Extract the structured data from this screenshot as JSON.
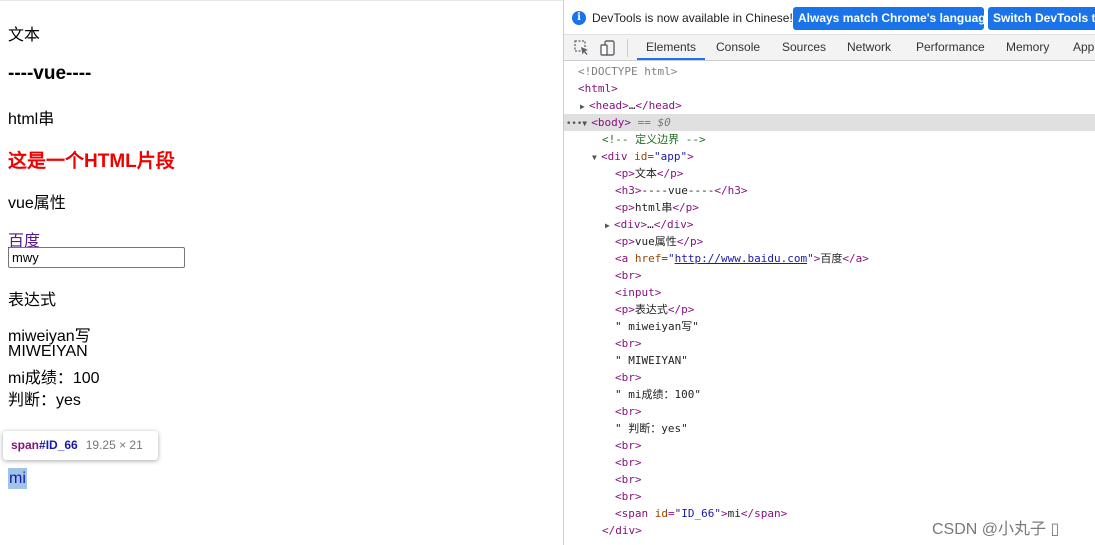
{
  "page": {
    "p_text": "文本",
    "h3_vue": "----vue----",
    "p_htmlstr": "html串",
    "html_fragment": "这是一个HTML片段",
    "p_vue_attr": "vue属性",
    "link_baidu": "百度",
    "input_value": "mwy",
    "p_expression": "表达式",
    "line1": "miweiyan写",
    "line2": "MIWEIYAN",
    "line3": "mi成绩：100",
    "line4": "判断：yes",
    "span_text": "mi",
    "tooltip_name": "span",
    "tooltip_id": "#ID_66",
    "tooltip_dims": "19.25 × 21"
  },
  "devtools": {
    "info_text": "DevTools is now available in Chinese!",
    "btn_match": "Always match Chrome's language",
    "btn_switch": "Switch DevTools to",
    "tabs": [
      "Elements",
      "Console",
      "Sources",
      "Network",
      "Performance",
      "Memory",
      "App"
    ],
    "tree": {
      "doctype": "<!DOCTYPE html>",
      "html_open": "<html>",
      "head_open": "<head>",
      "head_dots": "…",
      "head_close": "</head>",
      "body_open": "<body>",
      "body_marker": " == $0",
      "comment": "<!-- 定义边界 -->",
      "div_open_tag": "<div",
      "div_attr": "id",
      "div_val": "\"app\"",
      "gt": ">",
      "p": "<p>",
      "p_close": "</p>",
      "h3": "<h3>",
      "h3_close": "</h3>",
      "div_c": "<div>",
      "div_close": "</div>",
      "a_open": "<a",
      "a_attr": "href",
      "a_href": "http://www.baidu.com",
      "a_close": "</a>",
      "br": "<br>",
      "input": "<input>",
      "span_open": "<span",
      "span_attr": "id",
      "span_val": "\"ID_66\"",
      "span_close": "</span>",
      "t_text": "文本",
      "t_vue": "----vue----",
      "t_htmlstr": "html串",
      "t_vueattr": "vue属性",
      "t_baidu": "百度",
      "t_expr": "表达式",
      "t_s1": "\" miweiyan写\"",
      "t_s2": "\" MIWEIYAN\"",
      "t_s3": "\" mi成绩：100\"",
      "t_s4": "\" 判断：yes\"",
      "t_mi": "mi",
      "eq": "="
    }
  },
  "watermark": "CSDN @小丸子 ▯"
}
